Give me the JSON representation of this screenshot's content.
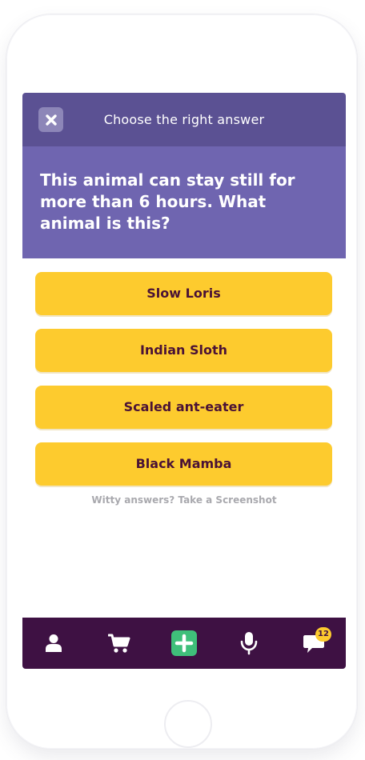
{
  "header": {
    "title": "Choose the right answer",
    "close_icon": "close-icon"
  },
  "question": {
    "text": "This animal can stay still for more than 6 hours. What animal is this?"
  },
  "answers": [
    {
      "label": "Slow Loris"
    },
    {
      "label": "Indian Sloth"
    },
    {
      "label": "Scaled ant-eater"
    },
    {
      "label": "Black Mamba"
    }
  ],
  "hint": {
    "text": "Witty answers? Take a Screenshot"
  },
  "bottom_nav": {
    "items": [
      {
        "icon": "profile-icon"
      },
      {
        "icon": "cart-icon"
      },
      {
        "icon": "add-icon"
      },
      {
        "icon": "microphone-icon"
      },
      {
        "icon": "chat-icon",
        "badge": "12"
      }
    ]
  },
  "colors": {
    "header_bg": "#5b5193",
    "question_bg": "#6f65b0",
    "answer_bg": "#fdcb2e",
    "answer_text": "#4a1236",
    "nav_bg": "#3e1143",
    "add_button": "#3fbf7a",
    "badge_bg": "#fdcb2e"
  }
}
